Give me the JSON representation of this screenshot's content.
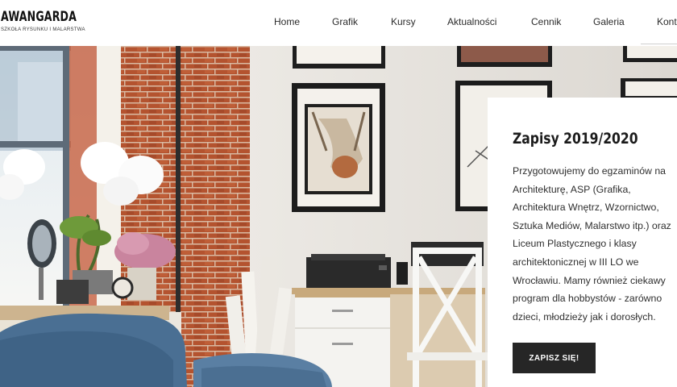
{
  "brand": {
    "name": "AWANGARDA",
    "tagline": "SZKOŁA RYSUNKU I MALARSTWA"
  },
  "nav": {
    "items": [
      {
        "label": "Home"
      },
      {
        "label": "Grafik"
      },
      {
        "label": "Kursy"
      },
      {
        "label": "Aktualności"
      },
      {
        "label": "Cennik"
      },
      {
        "label": "Galeria"
      },
      {
        "label": "Kont"
      }
    ]
  },
  "card": {
    "title": "Zapisy 2019/2020",
    "body_lines": [
      "Przygotowujemy do egzaminów na",
      "Architekturę, ASP (Grafika,",
      "Architektura Wnętrz, Wzornictwo,",
      "Sztuka Mediów, Malarstwo itp.) oraz",
      "Liceum Plastycznego i klasy",
      "architektonicznej w III LO we",
      "Wrocławiu. Mamy również ciekawy",
      "program dla hobbystów - zarówno",
      "dzieci, młodzieży jak i dorosłych."
    ],
    "button_label": "ZAPISZ SIĘ!"
  },
  "colors": {
    "brick": "#b4532f",
    "wall": "#e8e4de",
    "sofa": "#4a6f93",
    "button": "#262626"
  },
  "icons": {
    "hero": "studio-photo"
  }
}
